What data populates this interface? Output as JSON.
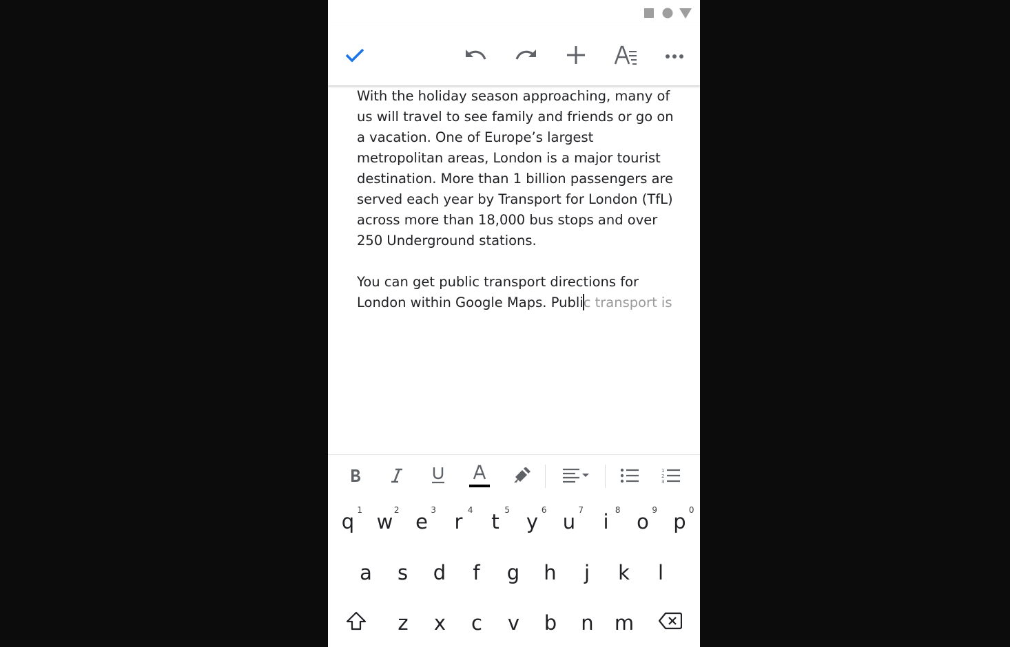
{
  "document": {
    "paragraph1": "With the holiday season approaching, many of us will travel to see family and friends or go on a vacation. One of Europe’s largest metropolitan areas, London is a major tourist destination. More than 1 billion passengers are served each year by Transport for London (TfL) across more than 18,000 bus stops and over 250 Underground stations.",
    "paragraph2_typed": "You can get public transport directions for London within Google Maps. Publi",
    "paragraph2_suggestion": "c transport is"
  },
  "icons": {
    "status": [
      "stop-icon",
      "circle-icon",
      "triangle-icon"
    ],
    "toolbar": [
      "check-icon",
      "undo-icon",
      "redo-icon",
      "add-icon",
      "text-format-icon",
      "more-icon"
    ],
    "format_bar": [
      "bold-icon",
      "italic-icon",
      "underline-icon",
      "text-color-icon",
      "highlight-icon",
      "align-icon",
      "bullet-list-icon",
      "numbered-list-icon"
    ]
  },
  "colors": {
    "accent": "#1a73e8",
    "text": "#202124",
    "suggestion": "#9a9a9a",
    "icon": "#5f6368"
  },
  "keyboard": {
    "row1": [
      {
        "key": "q",
        "hint": "1"
      },
      {
        "key": "w",
        "hint": "2"
      },
      {
        "key": "e",
        "hint": "3"
      },
      {
        "key": "r",
        "hint": "4"
      },
      {
        "key": "t",
        "hint": "5"
      },
      {
        "key": "y",
        "hint": "6"
      },
      {
        "key": "u",
        "hint": "7"
      },
      {
        "key": "i",
        "hint": "8"
      },
      {
        "key": "o",
        "hint": "9"
      },
      {
        "key": "p",
        "hint": "0"
      }
    ],
    "row2": [
      "a",
      "s",
      "d",
      "f",
      "g",
      "h",
      "j",
      "k",
      "l"
    ],
    "row3": [
      "z",
      "x",
      "c",
      "v",
      "b",
      "n",
      "m"
    ]
  }
}
